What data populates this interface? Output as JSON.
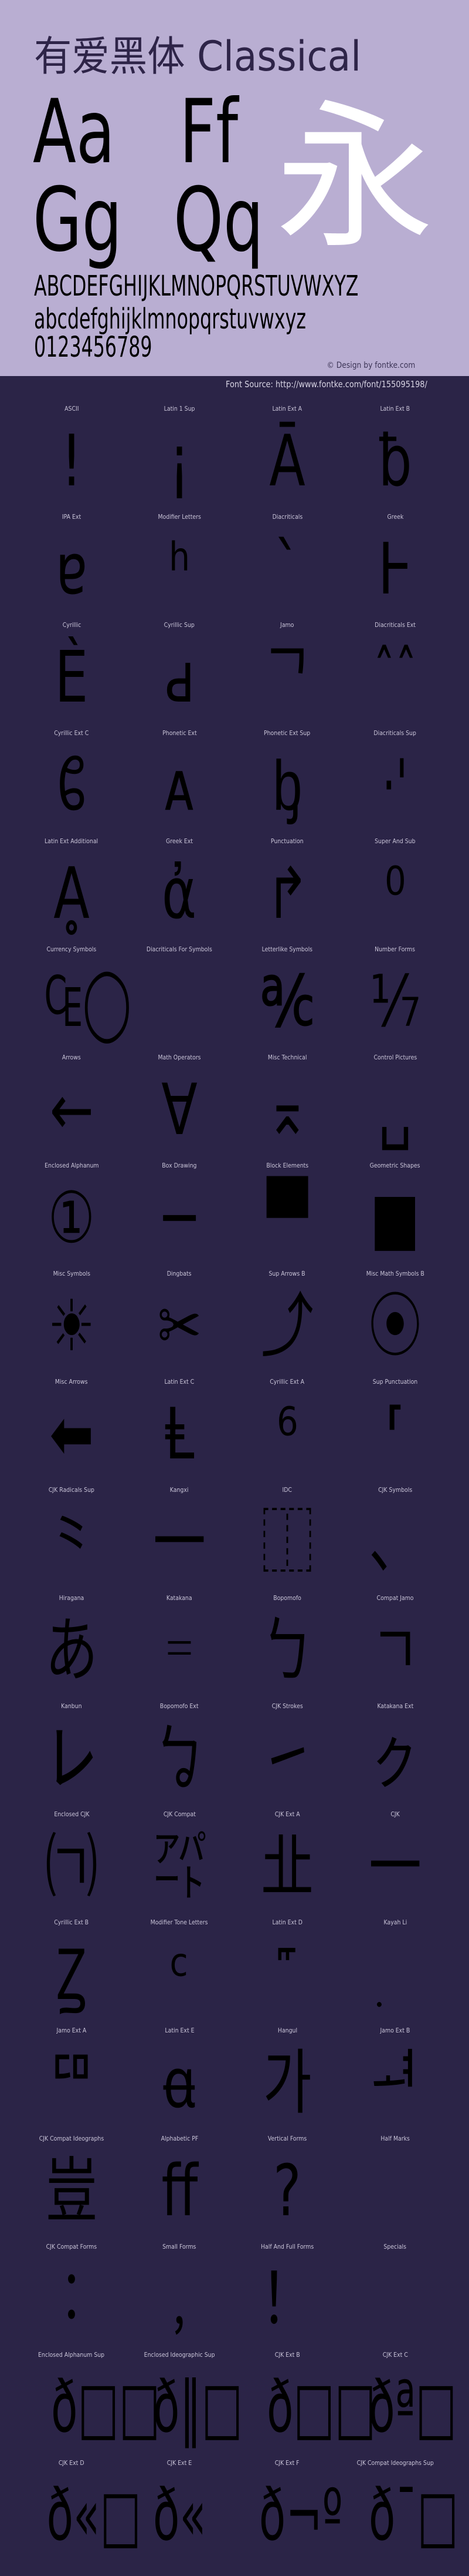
{
  "header": {
    "title": "有爱黑体 Classical",
    "sample_pairs": [
      "Aa",
      "Ff",
      "Gg",
      "Qq"
    ],
    "hero_glyph": "永",
    "uppercase": "ABCDEFGHIJKLMNOPQRSTUVWXYZ",
    "lowercase": "abcdefghijklmnopqrstuvwxyz",
    "digits": "0123456789",
    "credit": "© Design by fontke.com",
    "background_color": "#b9aed2",
    "hero_color": "#ffffff"
  },
  "source": "Font Source: http://www.fontke.com/font/155095198/",
  "grid_background_color": "#2b2447",
  "blocks": [
    {
      "label": "ASCII",
      "glyph": "!"
    },
    {
      "label": "Latin 1 Sup",
      "glyph": "¡"
    },
    {
      "label": "Latin Ext A",
      "glyph": "Ā"
    },
    {
      "label": "Latin Ext B",
      "glyph": "ƀ"
    },
    {
      "label": "IPA Ext",
      "glyph": "ɐ"
    },
    {
      "label": "Modifier Letters",
      "glyph": "ʰ"
    },
    {
      "label": "Diacriticals",
      "glyph": "ˋ"
    },
    {
      "label": "Greek",
      "glyph": "Ͱ"
    },
    {
      "label": "Cyrillic",
      "glyph": "Ѐ"
    },
    {
      "label": "Cyrillic Sup",
      "glyph": "ԁ"
    },
    {
      "label": "Jamo",
      "glyph": "ᄀ"
    },
    {
      "label": "Diacriticals Ext",
      "glyph": "ˆˆ"
    },
    {
      "label": "Cyrillic Ext C",
      "glyph": "ᲀ"
    },
    {
      "label": "Phonetic Ext",
      "glyph": "ᴀ"
    },
    {
      "label": "Phonetic Ext Sup",
      "glyph": "ᶀ"
    },
    {
      "label": "Diacriticals Sup",
      "glyph": "·'"
    },
    {
      "label": "Latin Ext Additional",
      "glyph": "Ḁ"
    },
    {
      "label": "Greek Ext",
      "glyph": "ἀ"
    },
    {
      "label": "Punctuation",
      "glyph": "↱"
    },
    {
      "label": "Super And Sub",
      "glyph": "⁰"
    },
    {
      "label": "Currency Symbols",
      "glyph": "₠◯"
    },
    {
      "label": "Diacriticals For Symbols",
      "glyph": ""
    },
    {
      "label": "Letterlike Symbols",
      "glyph": "℀"
    },
    {
      "label": "Number Forms",
      "glyph": "⅐"
    },
    {
      "label": "Arrows",
      "glyph": "←"
    },
    {
      "label": "Math Operators",
      "glyph": "∀"
    },
    {
      "label": "Misc Technical",
      "glyph": "⌅"
    },
    {
      "label": "Control Pictures",
      "glyph": "␣"
    },
    {
      "label": "Enclosed Alphanum",
      "glyph": "①"
    },
    {
      "label": "Box Drawing",
      "glyph": "─"
    },
    {
      "label": "Block Elements",
      "glyph": "▀"
    },
    {
      "label": "Geometric Shapes",
      "glyph": "■"
    },
    {
      "label": "Misc Symbols",
      "glyph": "☀"
    },
    {
      "label": "Dingbats",
      "glyph": "✂"
    },
    {
      "label": "Sup Arrows B",
      "glyph": "⤴"
    },
    {
      "label": "Misc Math Symbols B",
      "glyph": "⦿"
    },
    {
      "label": "Misc Arrows",
      "glyph": "⬅"
    },
    {
      "label": "Latin Ext C",
      "glyph": "Ⱡ"
    },
    {
      "label": "Cyrillic Ext A",
      "glyph": "⁶"
    },
    {
      "label": "Sup Punctuation",
      "glyph": "⸢"
    },
    {
      "label": "CJK Radicals Sup",
      "glyph": "⺀"
    },
    {
      "label": "Kangxi",
      "glyph": "⼀"
    },
    {
      "label": "IDC",
      "glyph": "⿰"
    },
    {
      "label": "CJK Symbols",
      "glyph": "、"
    },
    {
      "label": "Hiragana",
      "glyph": "あ"
    },
    {
      "label": "Katakana",
      "glyph": "゠"
    },
    {
      "label": "Bopomofo",
      "glyph": "ㄅ"
    },
    {
      "label": "Compat Jamo",
      "glyph": "ㄱ"
    },
    {
      "label": "Kanbun",
      "glyph": "㆑"
    },
    {
      "label": "Bopomofo Ext",
      "glyph": "ㆠ"
    },
    {
      "label": "CJK Strokes",
      "glyph": "㇀"
    },
    {
      "label": "Katakana Ext",
      "glyph": "ㇰ"
    },
    {
      "label": "Enclosed CJK",
      "glyph": "㈀"
    },
    {
      "label": "CJK Compat",
      "glyph": "㌀"
    },
    {
      "label": "CJK Ext A",
      "glyph": "㐀"
    },
    {
      "label": "CJK",
      "glyph": "一"
    },
    {
      "label": "Cyrillic Ext B",
      "glyph": "Ꙁ"
    },
    {
      "label": "Modifier Tone Letters",
      "glyph": "ᶜ"
    },
    {
      "label": "Latin Ext D",
      "glyph": "꜠"
    },
    {
      "label": "Kayah Li",
      "glyph": "꤫"
    },
    {
      "label": "Jamo Ext A",
      "glyph": "ꥠ"
    },
    {
      "label": "Latin Ext E",
      "glyph": "ꬰ"
    },
    {
      "label": "Hangul",
      "glyph": "가"
    },
    {
      "label": "Jamo Ext B",
      "glyph": "ힰ"
    },
    {
      "label": "CJK Compat Ideographs",
      "glyph": "豈"
    },
    {
      "label": "Alphabetic PF",
      "glyph": "ﬀ"
    },
    {
      "label": "Vertical Forms",
      "glyph": "?"
    },
    {
      "label": "Half Marks",
      "glyph": ""
    },
    {
      "label": "CJK Compat Forms",
      "glyph": "︰"
    },
    {
      "label": "Small Forms",
      "glyph": "﹐"
    },
    {
      "label": "Half And Full Forms",
      "glyph": "！"
    },
    {
      "label": "Specials",
      "glyph": "￼"
    },
    {
      "label": "Enclosed Alphanum Sup",
      "glyph": "ð□□"
    },
    {
      "label": "Enclosed Ideographic Sup",
      "glyph": "ð‖□"
    },
    {
      "label": "CJK Ext B",
      "glyph": "ð□□"
    },
    {
      "label": "CJK Ext C",
      "glyph": "ðª□"
    },
    {
      "label": "CJK Ext D",
      "glyph": "ð«□"
    },
    {
      "label": "CJK Ext E",
      "glyph": "ð«"
    },
    {
      "label": "CJK Ext F",
      "glyph": "ð¬º"
    },
    {
      "label": "CJK Compat Ideographs Sup",
      "glyph": "ð¯□"
    }
  ]
}
